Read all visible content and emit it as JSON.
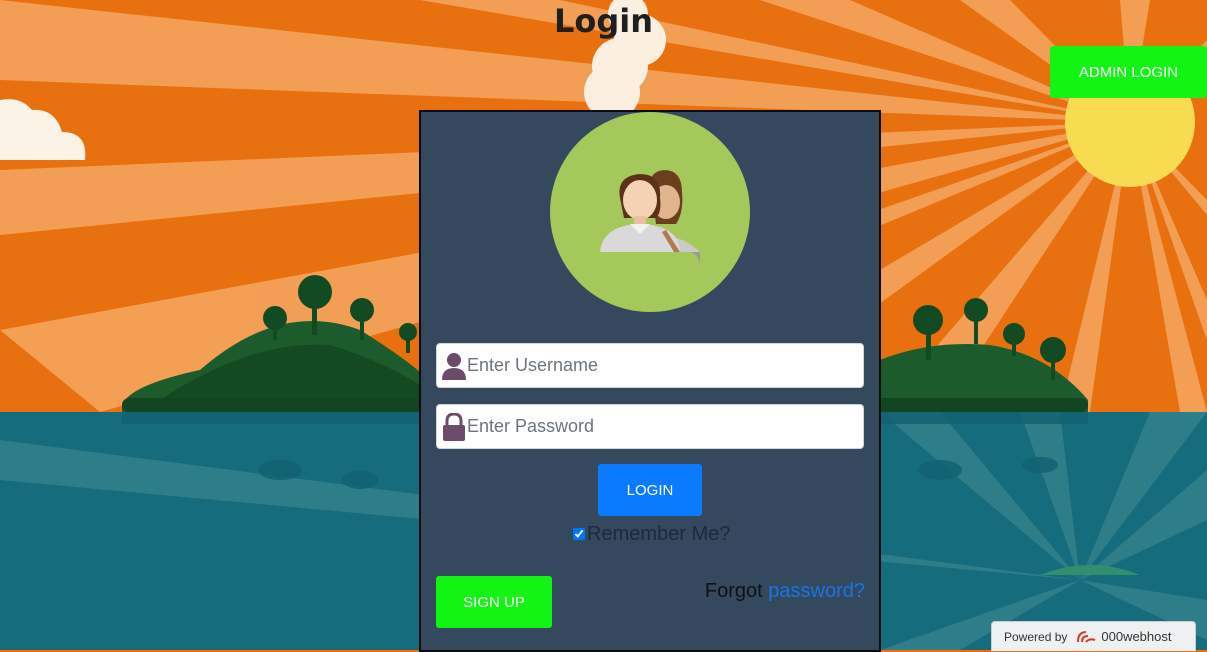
{
  "page": {
    "title": "Login"
  },
  "header": {
    "admin_login_label": "ADMIN LOGIN"
  },
  "form": {
    "username": {
      "placeholder": "Enter Username",
      "value": ""
    },
    "password": {
      "placeholder": "Enter Password",
      "value": ""
    },
    "login_label": "LOGIN",
    "remember_label": "Remember Me?",
    "remember_checked": true,
    "signup_label": "SIGN UP",
    "forgot_text": "Forgot",
    "forgot_link": "password?"
  },
  "footer": {
    "powered_by": "Powered by",
    "brand": "000webhost"
  },
  "colors": {
    "panel": "#34495e",
    "avatar_circle": "#a4c85a",
    "admin_button": "#12f514",
    "login_button": "#0a7bff",
    "signup_button": "#12f514",
    "link": "#1a73e8",
    "sky": "#e8700f",
    "sea": "#156c7c",
    "sun": "#f7dc52"
  },
  "icons": [
    "user-icon",
    "lock-icon",
    "avatar-users-icon",
    "000webhost-logo-icon"
  ]
}
